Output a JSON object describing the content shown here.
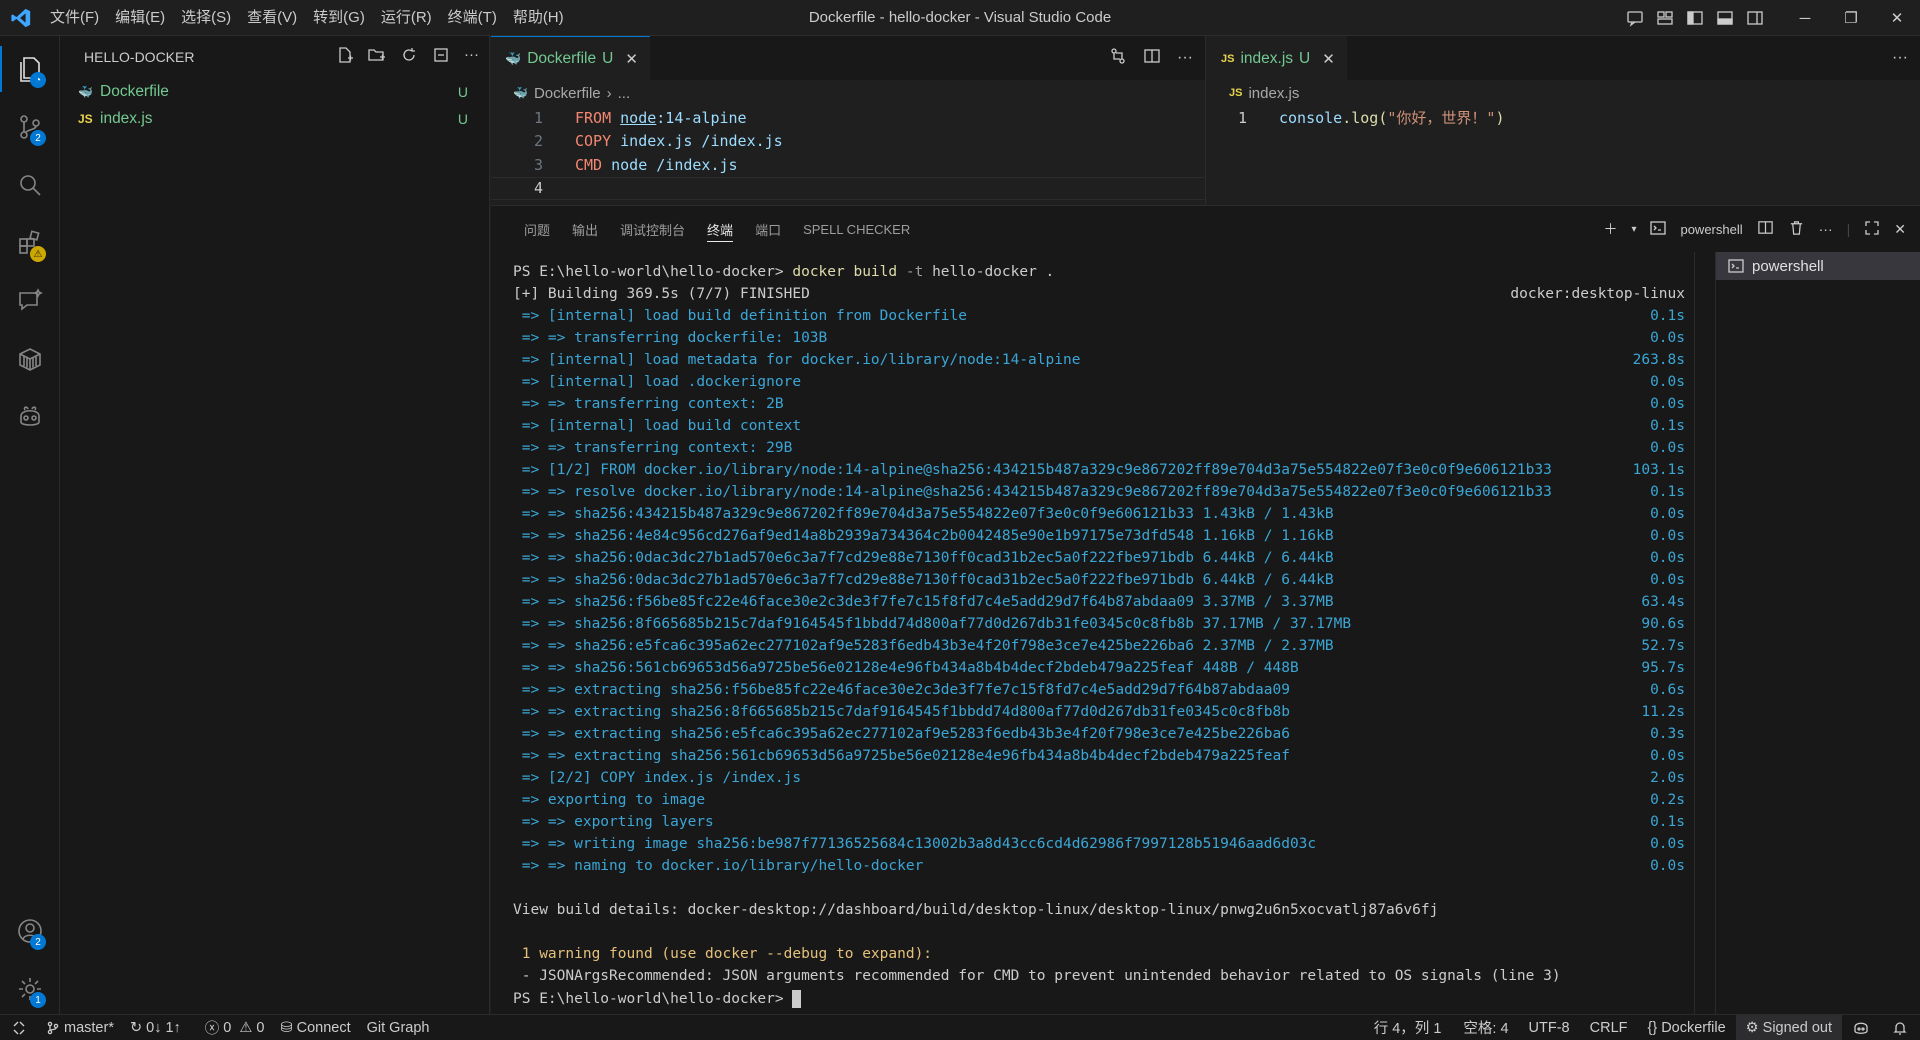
{
  "window": {
    "title": "Dockerfile - hello-docker - Visual Studio Code",
    "menu": [
      "文件(F)",
      "编辑(E)",
      "选择(S)",
      "查看(V)",
      "转到(G)",
      "运行(R)",
      "终端(T)",
      "帮助(H)"
    ]
  },
  "activity": {
    "scm_badge": "2",
    "extensions_badge": "⚠",
    "accounts_badge": "2",
    "settings_badge": "1"
  },
  "explorer": {
    "title": "HELLO-DOCKER",
    "files": [
      {
        "icon": "🐳",
        "name": "Dockerfile",
        "status": "U"
      },
      {
        "icon": "JS",
        "name": "index.js",
        "status": "U"
      }
    ]
  },
  "editor_left": {
    "tab_label": "Dockerfile",
    "tab_status": "U",
    "breadcrumb": [
      "Dockerfile",
      "..."
    ],
    "lines": [
      {
        "num": "1",
        "kw": "FROM",
        "rest": "node",
        "rest2": ":14-alpine"
      },
      {
        "num": "2",
        "kw": "COPY",
        "rest": "index.js /index.js",
        "rest2": ""
      },
      {
        "num": "3",
        "kw": "CMD",
        "rest": "node /index.js",
        "rest2": ""
      },
      {
        "num": "4",
        "kw": "",
        "rest": "",
        "rest2": ""
      }
    ]
  },
  "editor_right": {
    "tab_label": "index.js",
    "tab_status": "U",
    "breadcrumb": "index.js",
    "line_num": "1",
    "code_obj": "console",
    "code_fn": ".log(",
    "code_str": "\"你好，世界！\"",
    "code_end": ")"
  },
  "panel": {
    "tabs": [
      "问题",
      "输出",
      "调试控制台",
      "终端",
      "端口",
      "SPELL CHECKER"
    ],
    "active_tab": "终端",
    "shell_label": "powershell",
    "terminal_list_item": "powershell"
  },
  "terminal": {
    "prompt1": "PS E:\\hello-world\\hello-docker>",
    "cmd": "docker build",
    "cmd_flag": "-t",
    "cmd_rest": "hello-docker .",
    "building": "[+] Building 369.5s (7/7) FINISHED",
    "builder": "docker:desktop-linux",
    "steps": [
      {
        "t": " => [internal] load build definition from Dockerfile",
        "r": "0.1s"
      },
      {
        "t": " => => transferring dockerfile: 103B",
        "r": "0.0s"
      },
      {
        "t": " => [internal] load metadata for docker.io/library/node:14-alpine",
        "r": "263.8s"
      },
      {
        "t": " => [internal] load .dockerignore",
        "r": "0.0s"
      },
      {
        "t": " => => transferring context: 2B",
        "r": "0.0s"
      },
      {
        "t": " => [internal] load build context",
        "r": "0.1s"
      },
      {
        "t": " => => transferring context: 29B",
        "r": "0.0s"
      },
      {
        "t": " => [1/2] FROM docker.io/library/node:14-alpine@sha256:434215b487a329c9e867202ff89e704d3a75e554822e07f3e0c0f9e606121b33",
        "r": "103.1s"
      },
      {
        "t": " => => resolve docker.io/library/node:14-alpine@sha256:434215b487a329c9e867202ff89e704d3a75e554822e07f3e0c0f9e606121b33",
        "r": "0.1s"
      },
      {
        "t": " => => sha256:434215b487a329c9e867202ff89e704d3a75e554822e07f3e0c0f9e606121b33 1.43kB / 1.43kB",
        "r": "0.0s"
      },
      {
        "t": " => => sha256:4e84c956cd276af9ed14a8b2939a734364c2b0042485e90e1b97175e73dfd548 1.16kB / 1.16kB",
        "r": "0.0s"
      },
      {
        "t": " => => sha256:0dac3dc27b1ad570e6c3a7f7cd29e88e7130ff0cad31b2ec5a0f222fbe971bdb 6.44kB / 6.44kB",
        "r": "0.0s"
      },
      {
        "t": " => => sha256:0dac3dc27b1ad570e6c3a7f7cd29e88e7130ff0cad31b2ec5a0f222fbe971bdb 6.44kB / 6.44kB",
        "r": "0.0s"
      },
      {
        "t": " => => sha256:f56be85fc22e46face30e2c3de3f7fe7c15f8fd7c4e5add29d7f64b87abdaa09 3.37MB / 3.37MB",
        "r": "63.4s"
      },
      {
        "t": " => => sha256:8f665685b215c7daf9164545f1bbdd74d800af77d0d267db31fe0345c0c8fb8b 37.17MB / 37.17MB",
        "r": "90.6s"
      },
      {
        "t": " => => sha256:e5fca6c395a62ec277102af9e5283f6edb43b3e4f20f798e3ce7e425be226ba6 2.37MB / 2.37MB",
        "r": "52.7s"
      },
      {
        "t": " => => sha256:561cb69653d56a9725be56e02128e4e96fb434a8b4b4decf2bdeb479a225feaf 448B / 448B",
        "r": "95.7s"
      },
      {
        "t": " => => extracting sha256:f56be85fc22e46face30e2c3de3f7fe7c15f8fd7c4e5add29d7f64b87abdaa09",
        "r": "0.6s"
      },
      {
        "t": " => => extracting sha256:8f665685b215c7daf9164545f1bbdd74d800af77d0d267db31fe0345c0c8fb8b",
        "r": "11.2s"
      },
      {
        "t": " => => extracting sha256:e5fca6c395a62ec277102af9e5283f6edb43b3e4f20f798e3ce7e425be226ba6",
        "r": "0.3s"
      },
      {
        "t": " => => extracting sha256:561cb69653d56a9725be56e02128e4e96fb434a8b4b4decf2bdeb479a225feaf",
        "r": "0.0s"
      },
      {
        "t": " => [2/2] COPY index.js /index.js",
        "r": "2.0s"
      },
      {
        "t": " => exporting to image",
        "r": "0.2s"
      },
      {
        "t": " => => exporting layers",
        "r": "0.1s"
      },
      {
        "t": " => => writing image sha256:be987f77136525684c13002b3a8d43cc6cd4d62986f7997128b51946aad6d03c",
        "r": "0.0s"
      },
      {
        "t": " => => naming to docker.io/library/hello-docker",
        "r": "0.0s"
      }
    ],
    "details": "View build details: docker-desktop://dashboard/build/desktop-linux/desktop-linux/pnwg2u6n5xocvatlj87a6v6fj",
    "warning": " 1 warning found (use docker --debug to expand):",
    "warning_detail": " - JSONArgsRecommended: JSON arguments recommended for CMD to prevent unintended behavior related to OS signals (line 3)",
    "prompt2": "PS E:\\hello-world\\hello-docker>"
  },
  "status": {
    "branch": "master*",
    "sync": "0↓ 1↑",
    "errors": "0",
    "warnings": "0",
    "connect": "Connect",
    "git_graph": "Git Graph",
    "position": "行 4，列 1",
    "spaces": "空格: 4",
    "encoding": "UTF-8",
    "eol": "CRLF",
    "language": "Dockerfile",
    "signed": "Signed out"
  }
}
